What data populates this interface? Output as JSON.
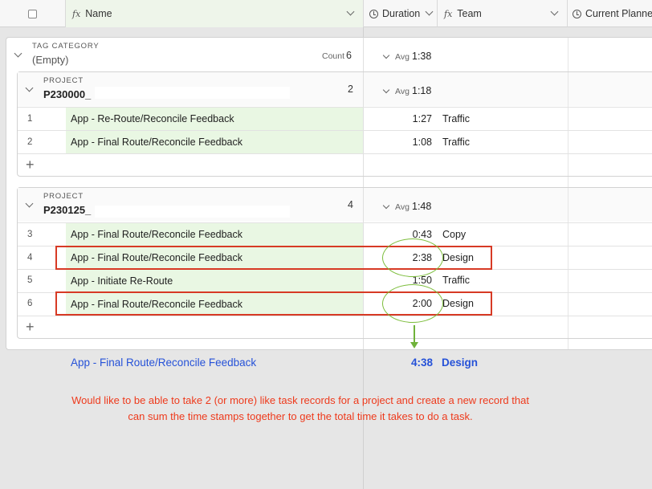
{
  "header": {
    "name_col": "Name",
    "duration_col": "Duration",
    "team_col": "Team",
    "planned_col": "Current Planne"
  },
  "outer_group": {
    "label": "TAG CATEGORY",
    "value": "(Empty)",
    "count_label": "Count",
    "count": "6",
    "avg_label": "Avg",
    "avg_value": "1:38"
  },
  "groups": [
    {
      "label": "PROJECT",
      "value": "P230000_",
      "count": "2",
      "avg_label": "Avg",
      "avg_value": "1:18",
      "rows": [
        {
          "num": "1",
          "name": "App - Re-Route/Reconcile Feedback",
          "duration": "1:27",
          "team": "Traffic"
        },
        {
          "num": "2",
          "name": "App - Final Route/Reconcile Feedback",
          "duration": "1:08",
          "team": "Traffic"
        }
      ]
    },
    {
      "label": "PROJECT",
      "value": "P230125_",
      "count": "4",
      "avg_label": "Avg",
      "avg_value": "1:48",
      "rows": [
        {
          "num": "3",
          "name": "App - Final Route/Reconcile Feedback",
          "duration": "0:43",
          "team": "Copy"
        },
        {
          "num": "4",
          "name": "App - Final Route/Reconcile Feedback",
          "duration": "2:38",
          "team": "Design"
        },
        {
          "num": "5",
          "name": "App - Initiate Re-Route",
          "duration": "1:50",
          "team": "Traffic"
        },
        {
          "num": "6",
          "name": "App - Final Route/Reconcile Feedback",
          "duration": "2:00",
          "team": "Design"
        }
      ]
    }
  ],
  "summary": {
    "name": "App - Final Route/Reconcile Feedback",
    "duration": "4:38",
    "team": "Design"
  },
  "note": {
    "line1": "Would like to be able to take 2 (or more) like task records for a project and create a new record that",
    "line2": "can sum the time stamps together to get the total time it takes to do a task."
  },
  "colors": {
    "annotation_red": "#d73a25",
    "annotation_green": "#7cbd3b",
    "summary_blue": "#2652d8",
    "name_cell_green": "#e9f7e3"
  }
}
